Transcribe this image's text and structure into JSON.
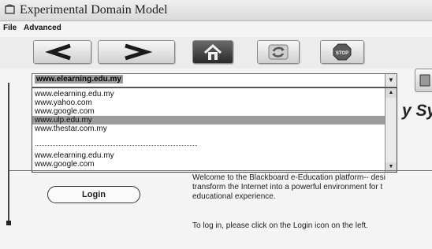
{
  "window": {
    "title": "Experimental Domain Model",
    "icon": "browser-app-icon"
  },
  "menu": {
    "items": [
      "File",
      "Advanced"
    ]
  },
  "toolbar": {
    "buttons": [
      {
        "name": "back",
        "icon": "left-arrow-icon"
      },
      {
        "name": "forward",
        "icon": "right-arrow-icon"
      },
      {
        "name": "home",
        "icon": "home-icon"
      },
      {
        "name": "refresh",
        "icon": "refresh-icon"
      },
      {
        "name": "stop",
        "icon": "stop-icon",
        "label": "STOP"
      }
    ]
  },
  "address": {
    "value": "www.elearning.edu.my",
    "dropdown_arrow": "▼"
  },
  "dropdown": {
    "items": [
      "www.elearning.edu.my",
      "www.yahoo.com",
      "www.google.com",
      "www.ulp.edu.my",
      "www.thestar.com.my",
      "www.elearning.edu.my",
      "www.google.com"
    ],
    "selected_index": 3,
    "scroll_up": "▲",
    "scroll_down": "▼"
  },
  "page": {
    "heading_fragment": "y Sy",
    "login_button": "Login",
    "welcome_lines": [
      "Welcome to the Blackboard e-Education platform-- desi",
      "transform the Internet into a powerful environment for t",
      "educational experience."
    ],
    "instruction": "To log in, please click on the Login icon on the left."
  }
}
